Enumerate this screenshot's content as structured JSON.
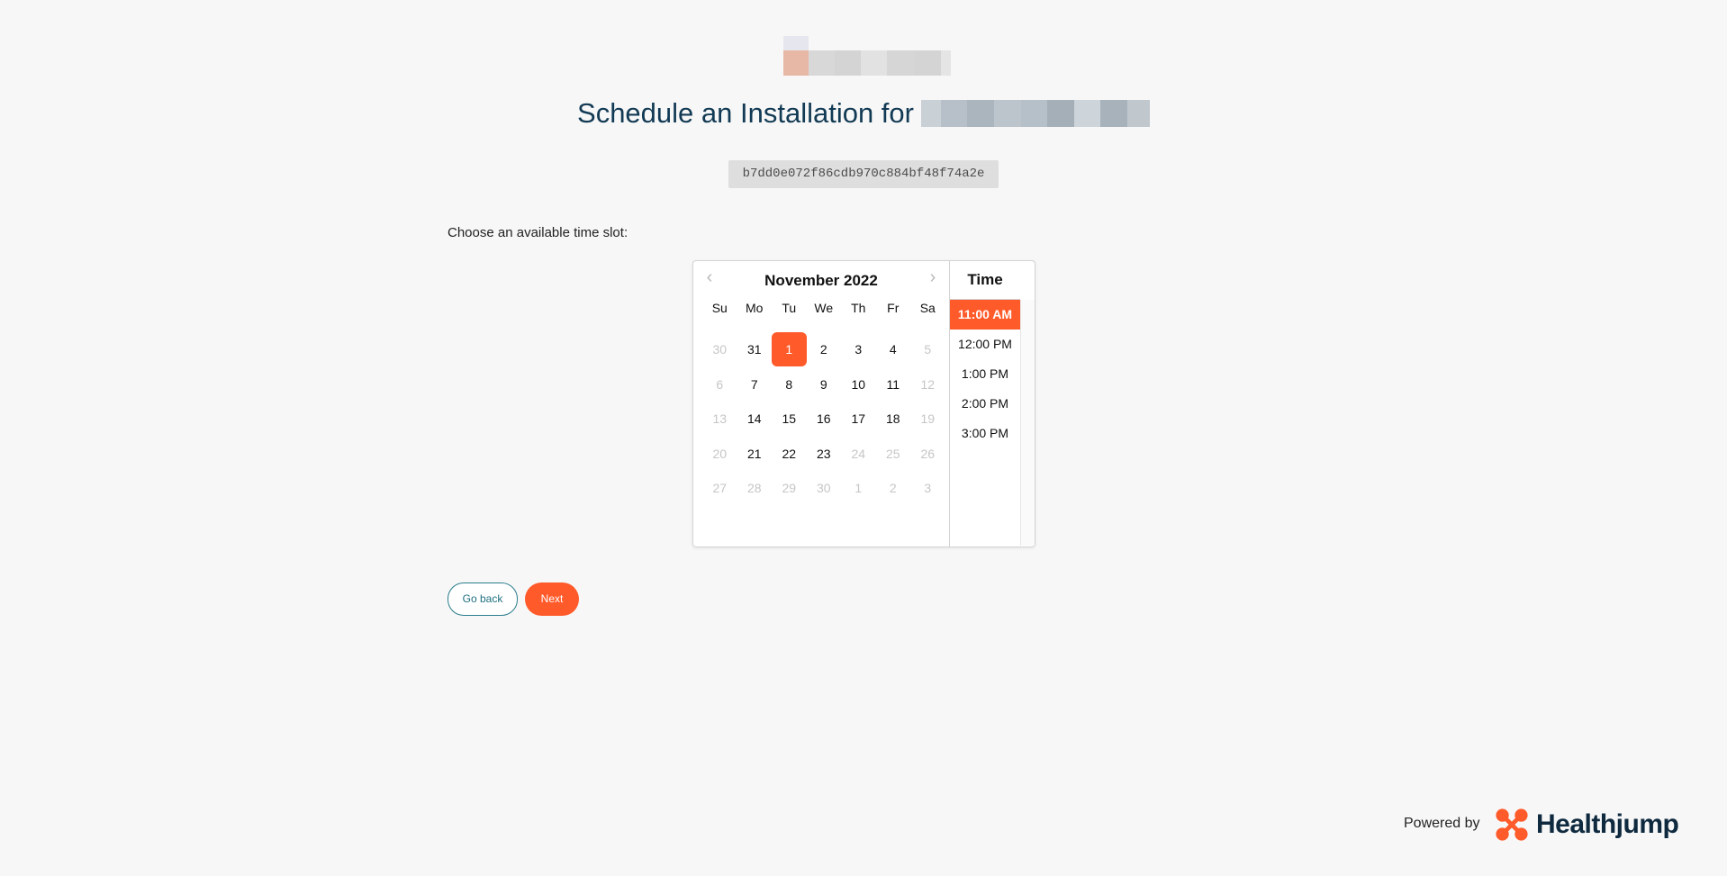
{
  "page": {
    "title_prefix": "Schedule an Installation for",
    "hash": "b7dd0e072f86cdb970c884bf48f74a2e",
    "prompt": "Choose an available time slot:"
  },
  "calendar": {
    "month_label": "November 2022",
    "prev_icon": "chevron-left-icon",
    "next_icon": "chevron-right-icon",
    "weekdays": [
      "Su",
      "Mo",
      "Tu",
      "We",
      "Th",
      "Fr",
      "Sa"
    ],
    "weeks": [
      [
        {
          "d": "30",
          "muted": true
        },
        {
          "d": "31",
          "muted": false
        },
        {
          "d": "1",
          "muted": false,
          "selected": true
        },
        {
          "d": "2",
          "muted": false
        },
        {
          "d": "3",
          "muted": false
        },
        {
          "d": "4",
          "muted": false
        },
        {
          "d": "5",
          "muted": true
        }
      ],
      [
        {
          "d": "6",
          "muted": true
        },
        {
          "d": "7",
          "muted": false
        },
        {
          "d": "8",
          "muted": false
        },
        {
          "d": "9",
          "muted": false
        },
        {
          "d": "10",
          "muted": false
        },
        {
          "d": "11",
          "muted": false
        },
        {
          "d": "12",
          "muted": true
        }
      ],
      [
        {
          "d": "13",
          "muted": true
        },
        {
          "d": "14",
          "muted": false
        },
        {
          "d": "15",
          "muted": false
        },
        {
          "d": "16",
          "muted": false
        },
        {
          "d": "17",
          "muted": false
        },
        {
          "d": "18",
          "muted": false
        },
        {
          "d": "19",
          "muted": true
        }
      ],
      [
        {
          "d": "20",
          "muted": true
        },
        {
          "d": "21",
          "muted": false
        },
        {
          "d": "22",
          "muted": false
        },
        {
          "d": "23",
          "muted": false
        },
        {
          "d": "24",
          "muted": true
        },
        {
          "d": "25",
          "muted": true
        },
        {
          "d": "26",
          "muted": true
        }
      ],
      [
        {
          "d": "27",
          "muted": true
        },
        {
          "d": "28",
          "muted": true
        },
        {
          "d": "29",
          "muted": true
        },
        {
          "d": "30",
          "muted": true
        },
        {
          "d": "1",
          "muted": true
        },
        {
          "d": "2",
          "muted": true
        },
        {
          "d": "3",
          "muted": true
        }
      ]
    ]
  },
  "time": {
    "header": "Time",
    "slots": [
      {
        "label": "11:00 AM",
        "selected": true
      },
      {
        "label": "12:00 PM",
        "selected": false
      },
      {
        "label": "1:00 PM",
        "selected": false
      },
      {
        "label": "2:00 PM",
        "selected": false
      },
      {
        "label": "3:00 PM",
        "selected": false
      }
    ]
  },
  "buttons": {
    "back_label": "Go back",
    "next_label": "Next"
  },
  "footer": {
    "powered_by": "Powered by",
    "brand_name": "Healthjump",
    "brand_icon": "healthjump-logo-icon"
  },
  "colors": {
    "accent": "#ff5a2a",
    "title": "#123a54",
    "teal": "#2a7d8c",
    "background": "#f7f7f7"
  }
}
